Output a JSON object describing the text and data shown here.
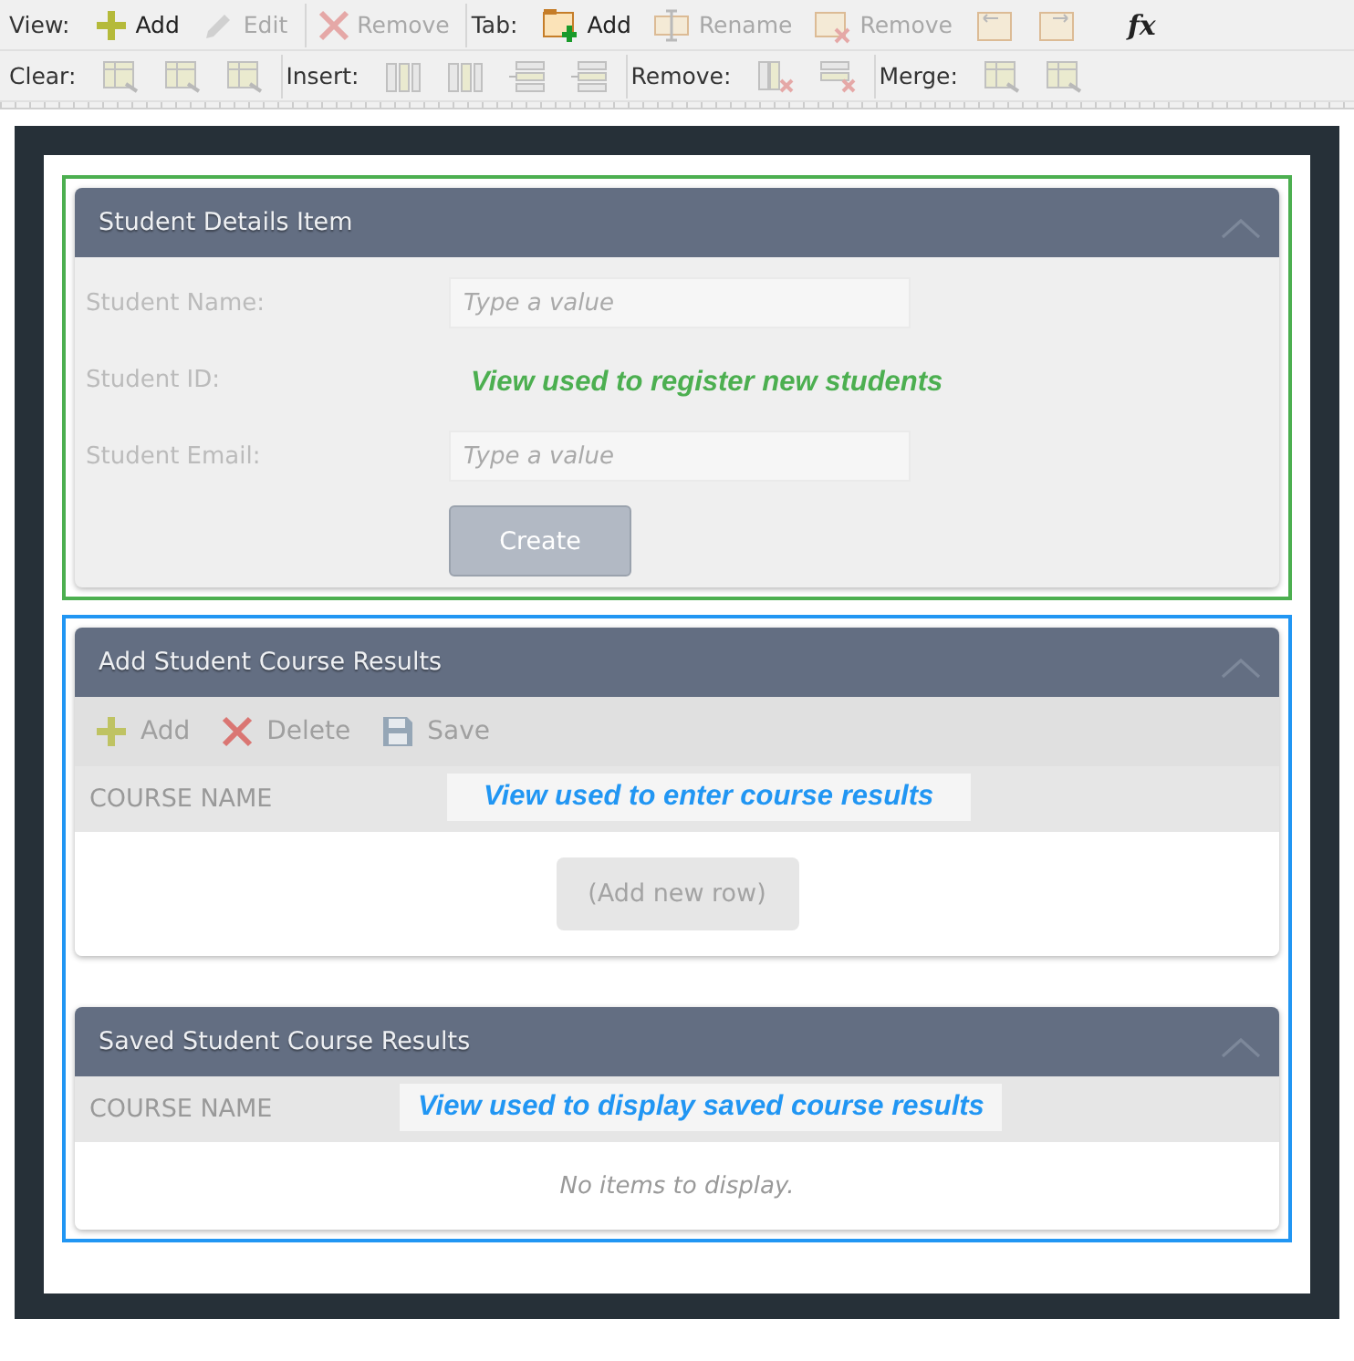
{
  "toolbar": {
    "rows": [
      {
        "groups": [
          {
            "label": "View:",
            "items": [
              {
                "kind": "button",
                "text": "Add",
                "disabled": false
              },
              {
                "kind": "button",
                "text": "Edit",
                "disabled": true
              }
            ]
          },
          {
            "items": [
              {
                "kind": "button",
                "text": "Remove",
                "disabled": true
              }
            ]
          },
          {
            "label": "Tab:",
            "items": [
              {
                "kind": "button",
                "text": "Add",
                "disabled": false
              },
              {
                "kind": "button",
                "text": "Rename",
                "disabled": true
              },
              {
                "kind": "button",
                "text": "Remove",
                "disabled": true
              },
              {
                "kind": "button",
                "disabled": true
              },
              {
                "kind": "button",
                "disabled": true
              },
              {
                "kind": "glyph",
                "text": "fx",
                "disabled": false
              }
            ]
          }
        ]
      },
      {
        "groups": [
          {
            "label": "Clear:",
            "items": [
              {
                "kind": "button",
                "disabled": true
              },
              {
                "kind": "button",
                "disabled": true
              },
              {
                "kind": "button",
                "disabled": true
              }
            ]
          },
          {
            "label": "Insert:",
            "items": [
              {
                "kind": "button",
                "disabled": true
              },
              {
                "kind": "button",
                "disabled": true
              },
              {
                "kind": "button",
                "disabled": true
              },
              {
                "kind": "button",
                "disabled": true
              }
            ]
          },
          {
            "label": "Remove:",
            "items": [
              {
                "kind": "button",
                "disabled": true
              },
              {
                "kind": "button",
                "disabled": true
              }
            ]
          },
          {
            "label": "Merge:",
            "items": [
              {
                "kind": "button",
                "disabled": true
              },
              {
                "kind": "button",
                "disabled": true
              }
            ]
          }
        ]
      }
    ]
  },
  "views": [
    {
      "color": "#4caf50",
      "panels": [
        {
          "kind": "form",
          "title": "Student Details Item",
          "note": "View used to register new students",
          "fields": [
            {
              "label": "Student Name:",
              "kind": "input",
              "placeholder": "Type a value"
            },
            {
              "label": "Student ID:",
              "kind": "label"
            },
            {
              "label": "Student Email:",
              "kind": "input",
              "placeholder": "Type a value"
            }
          ],
          "button": "Create"
        }
      ]
    },
    {
      "color": "#2196f3",
      "panels": [
        {
          "kind": "grid",
          "title": "Add Student Course Results",
          "actions": [
            "Add",
            "Delete",
            "Save"
          ],
          "columns": [
            "COURSE NAME"
          ],
          "note": "View used to enter course results",
          "add_row": "(Add new row)"
        },
        {
          "kind": "grid",
          "title": "Saved Student Course Results",
          "columns": [
            "COURSE NAME"
          ],
          "note": "View used to display saved course results",
          "empty": "No items to display."
        }
      ]
    }
  ]
}
